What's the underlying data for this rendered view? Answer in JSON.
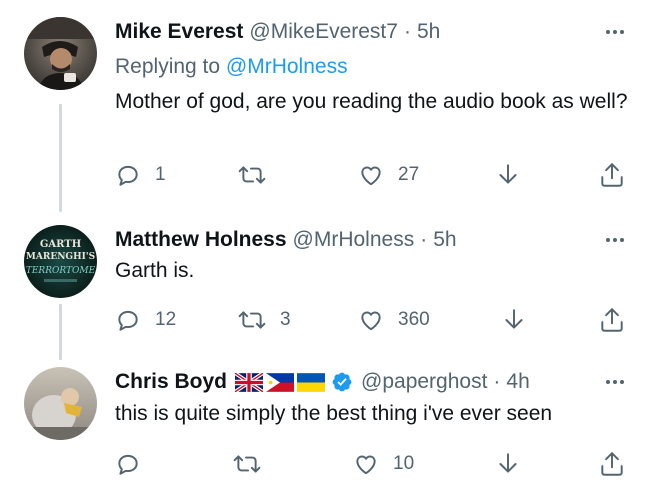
{
  "tweets": [
    {
      "name": "Mike Everest",
      "handle": "@MikeEverest7",
      "separator": "·",
      "time": "5h",
      "replying_prefix": "Replying to",
      "replying_to": "@MrHolness",
      "text": "Mother of god, are you reading the audio book as well?",
      "replies": "1",
      "retweets": "",
      "likes": "27"
    },
    {
      "name": "Matthew Holness",
      "handle": "@MrHolness",
      "separator": "·",
      "time": "5h",
      "text": "Garth is.",
      "replies": "12",
      "retweets": "3",
      "likes": "360",
      "avatar_text": [
        "GARTH",
        "MARENGHI'S",
        "TERRORTOME"
      ]
    },
    {
      "name": "Chris Boyd",
      "handle": "@paperghost",
      "separator": "·",
      "time": "4h",
      "text": "this is quite simply the best thing i've ever seen",
      "replies": "",
      "retweets": "",
      "likes": "10",
      "flags": [
        "uk-flag",
        "philippines-flag",
        "ukraine-flag"
      ],
      "verified": true
    }
  ],
  "colors": {
    "text": "#0f1419",
    "secondary": "#536471",
    "link": "#1d9bf0",
    "thread_line": "#cfd9de"
  }
}
